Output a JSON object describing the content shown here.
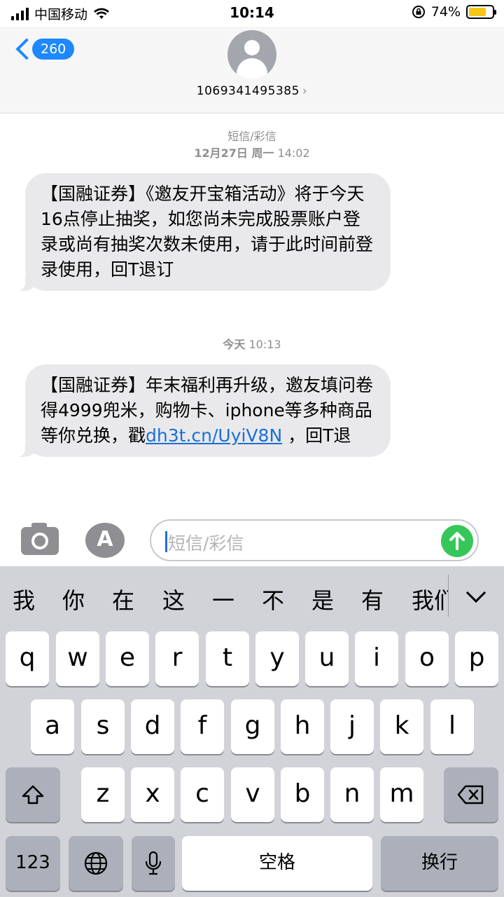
{
  "status_bar": {
    "carrier": "中国移动",
    "time": "10:14",
    "battery_percent": "74%",
    "battery_level": 0.74
  },
  "header": {
    "back_badge": "260",
    "contact_number": "1069341495385",
    "contact_chevron": "›"
  },
  "thread": {
    "ts1_label": "短信/彩信",
    "ts1_date": "12月27日 周一",
    "ts1_time": "14:02",
    "msg1": "【国融证券】《邀友开宝箱活动》将于今天16点停止抽奖，如您尚未完成股票账户登录或尚有抽奖次数未使用，请于此时间前登录使用，回T退订",
    "ts2_day": "今天",
    "ts2_time": "10:13",
    "msg2_before": "【国融证券】年末福利再升级，邀友填问卷得4999兜米，购物卡、iphone等多种商品等你兑换，戳",
    "msg2_link": "dh3t.cn/UyiV8N",
    "msg2_after": " ，回T退"
  },
  "compose": {
    "placeholder": "短信/彩信",
    "send_icon": "arrow-up-icon",
    "camera_icon": "camera-icon",
    "apps_icon": "app-store-icon",
    "apps_glyph": "A"
  },
  "keyboard": {
    "candidates": [
      "我",
      "你",
      "在",
      "这",
      "一",
      "不",
      "是",
      "有",
      "我们"
    ],
    "row1": [
      "q",
      "w",
      "e",
      "r",
      "t",
      "y",
      "u",
      "i",
      "o",
      "p"
    ],
    "row2": [
      "a",
      "s",
      "d",
      "f",
      "g",
      "h",
      "j",
      "k",
      "l"
    ],
    "row3": [
      "z",
      "x",
      "c",
      "v",
      "b",
      "n",
      "m"
    ],
    "numbers_key": "123",
    "space_key": "空格",
    "return_key": "换行",
    "globe_icon": "globe-icon",
    "mic_icon": "microphone-icon",
    "shift_icon": "shift-icon",
    "delete_icon": "delete-icon"
  },
  "colors": {
    "accent_blue": "#1e88ff",
    "send_green": "#35c759",
    "bubble_gray": "#e9e9eb",
    "keyboard_bg": "#d1d3d9"
  }
}
